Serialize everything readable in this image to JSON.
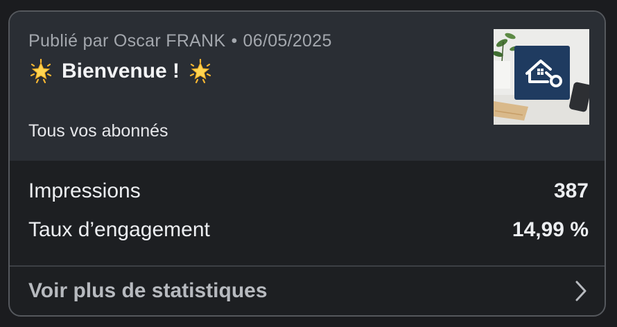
{
  "post": {
    "published_prefix": "Publié par",
    "author": "Oscar FRANK",
    "separator": "•",
    "date": "06/05/2025",
    "title": "Bienvenue !",
    "title_icon": "glowing-star-emoji",
    "audience": "Tous vos abonnés",
    "thumbnail": "house-key-sign-image"
  },
  "stats": {
    "impressions_label": "Impressions",
    "impressions_value": "387",
    "engagement_label": "Taux d’engagement",
    "engagement_value": "14,99 %"
  },
  "footer": {
    "more_label": "Voir plus de statistiques",
    "chevron_icon": "chevron-right-icon"
  },
  "colors": {
    "background": "#1b1c1f",
    "header_bg": "#2a2e34",
    "card_border": "#55585d",
    "text_primary": "#eceef1",
    "text_secondary": "#a3a7ad",
    "star": "#f5c542",
    "thumb_sign": "#1f3b60"
  }
}
